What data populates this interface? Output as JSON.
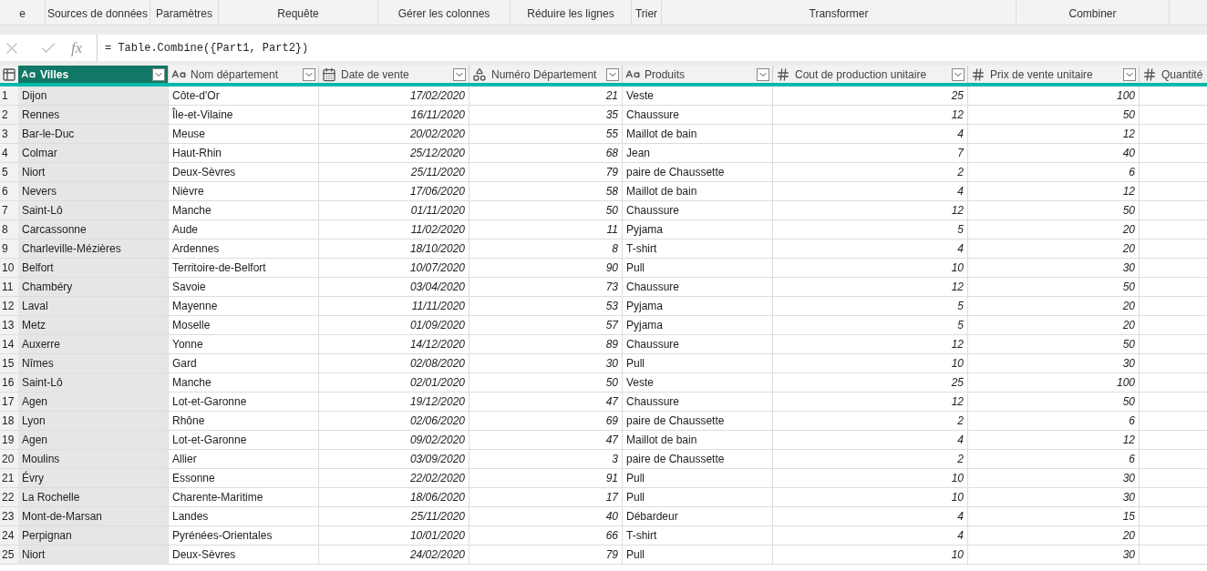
{
  "ribbon": {
    "groups": [
      {
        "label": "e"
      },
      {
        "label": "Sources de données"
      },
      {
        "label": "Paramètres"
      },
      {
        "label": "Requête"
      },
      {
        "label": "Gérer les colonnes"
      },
      {
        "label": "Réduire les lignes"
      },
      {
        "label": "Trier"
      },
      {
        "label": "Transformer"
      },
      {
        "label": "Combiner"
      }
    ]
  },
  "formula_bar": {
    "cancel_disabled": true,
    "confirm_disabled": true,
    "fx_label": "fx",
    "formula": "= Table.Combine({Part1, Part2})"
  },
  "table": {
    "columns": [
      {
        "name": "Villes",
        "kind": "text",
        "selected": true
      },
      {
        "name": "Nom département",
        "kind": "text",
        "selected": false
      },
      {
        "name": "Date de vente",
        "kind": "date",
        "selected": false
      },
      {
        "name": "Numéro Département",
        "kind": "any",
        "selected": false
      },
      {
        "name": "Produits",
        "kind": "text",
        "selected": false
      },
      {
        "name": "Cout de production unitaire",
        "kind": "number",
        "selected": false
      },
      {
        "name": "Prix de vente unitaire",
        "kind": "number",
        "selected": false
      },
      {
        "name": "Quantité",
        "kind": "number",
        "selected": false
      }
    ],
    "rows": [
      [
        "1",
        "Dijon",
        "Côte-d'Or",
        "17/02/2020",
        "21",
        "Veste",
        "25",
        "100"
      ],
      [
        "2",
        "Rennes",
        "Île-et-Vilaine",
        "16/11/2020",
        "35",
        "Chaussure",
        "12",
        "50"
      ],
      [
        "3",
        "Bar-le-Duc",
        "Meuse",
        "20/02/2020",
        "55",
        "Maillot de bain",
        "4",
        "12"
      ],
      [
        "4",
        "Colmar",
        "Haut-Rhin",
        "25/12/2020",
        "68",
        "Jean",
        "7",
        "40"
      ],
      [
        "5",
        "Niort",
        "Deux-Sèvres",
        "25/11/2020",
        "79",
        "paire de Chaussette",
        "2",
        "6"
      ],
      [
        "6",
        "Nevers",
        "Nièvre",
        "17/06/2020",
        "58",
        "Maillot de bain",
        "4",
        "12"
      ],
      [
        "7",
        "Saint-Lô",
        "Manche",
        "01/11/2020",
        "50",
        "Chaussure",
        "12",
        "50"
      ],
      [
        "8",
        "Carcassonne",
        "Aude",
        "11/02/2020",
        "11",
        "Pyjama",
        "5",
        "20"
      ],
      [
        "9",
        "Charleville-Mézières",
        "Ardennes",
        "18/10/2020",
        "8",
        "T-shirt",
        "4",
        "20"
      ],
      [
        "10",
        "Belfort",
        "Territoire-de-Belfort",
        "10/07/2020",
        "90",
        "Pull",
        "10",
        "30"
      ],
      [
        "11",
        "Chambéry",
        "Savoie",
        "03/04/2020",
        "73",
        "Chaussure",
        "12",
        "50"
      ],
      [
        "12",
        "Laval",
        "Mayenne",
        "11/11/2020",
        "53",
        "Pyjama",
        "5",
        "20"
      ],
      [
        "13",
        "Metz",
        "Moselle",
        "01/09/2020",
        "57",
        "Pyjama",
        "5",
        "20"
      ],
      [
        "14",
        "Auxerre",
        "Yonne",
        "14/12/2020",
        "89",
        "Chaussure",
        "12",
        "50"
      ],
      [
        "15",
        "Nîmes",
        "Gard",
        "02/08/2020",
        "30",
        "Pull",
        "10",
        "30"
      ],
      [
        "16",
        "Saint-Lô",
        "Manche",
        "02/01/2020",
        "50",
        "Veste",
        "25",
        "100"
      ],
      [
        "17",
        "Agen",
        "Lot-et-Garonne",
        "19/12/2020",
        "47",
        "Chaussure",
        "12",
        "50"
      ],
      [
        "18",
        "Lyon",
        "Rhône",
        "02/06/2020",
        "69",
        "paire de Chaussette",
        "2",
        "6"
      ],
      [
        "19",
        "Agen",
        "Lot-et-Garonne",
        "09/02/2020",
        "47",
        "Maillot de bain",
        "4",
        "12"
      ],
      [
        "20",
        "Moulins",
        "Allier",
        "03/09/2020",
        "3",
        "paire de Chaussette",
        "2",
        "6"
      ],
      [
        "21",
        "Évry",
        "Essonne",
        "22/02/2020",
        "91",
        "Pull",
        "10",
        "30"
      ],
      [
        "22",
        "La Rochelle",
        "Charente-Maritime",
        "18/06/2020",
        "17",
        "Pull",
        "10",
        "30"
      ],
      [
        "23",
        "Mont-de-Marsan",
        "Landes",
        "25/11/2020",
        "40",
        "Débardeur",
        "4",
        "15"
      ],
      [
        "24",
        "Perpignan",
        "Pyrénées-Orientales",
        "10/01/2020",
        "66",
        "T-shirt",
        "4",
        "20"
      ],
      [
        "25",
        "Niort",
        "Deux-Sèvres",
        "24/02/2020",
        "79",
        "Pull",
        "10",
        "30"
      ]
    ]
  }
}
